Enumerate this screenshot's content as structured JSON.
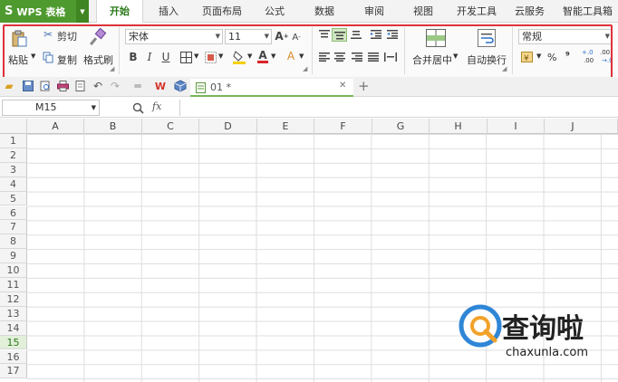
{
  "app": {
    "logo": "S",
    "name": "WPS 表格"
  },
  "menu_tabs": [
    "开始",
    "插入",
    "页面布局",
    "公式",
    "数据",
    "审阅",
    "视图",
    "开发工具",
    "云服务",
    "智能工具箱"
  ],
  "ribbon": {
    "paste": "粘贴",
    "cut": "剪切",
    "copy": "复制",
    "format_painter": "格式刷",
    "font_name": "宋体",
    "font_size": "11",
    "merge_center": "合并居中",
    "wrap_text": "自动换行",
    "number_format": "常规",
    "percent": "%",
    "comma": "⁹",
    "inc_decimal": "+.0",
    "dec_decimal": ".00"
  },
  "doc_tab": {
    "name": "01 *"
  },
  "formula_bar": {
    "cell_ref": "M15",
    "fx": "fx"
  },
  "columns": [
    "A",
    "B",
    "C",
    "D",
    "E",
    "F",
    "G",
    "H",
    "I",
    "J"
  ],
  "rows": [
    "1",
    "2",
    "3",
    "4",
    "5",
    "6",
    "7",
    "8",
    "9",
    "10",
    "11",
    "12",
    "13",
    "14",
    "15",
    "16",
    "17"
  ],
  "selected_row": "15",
  "watermark": {
    "text": "查询啦",
    "sub": "chaxunla.com"
  },
  "colors": {
    "accent": "#4f9a2f",
    "highlight": "#e0323a"
  }
}
